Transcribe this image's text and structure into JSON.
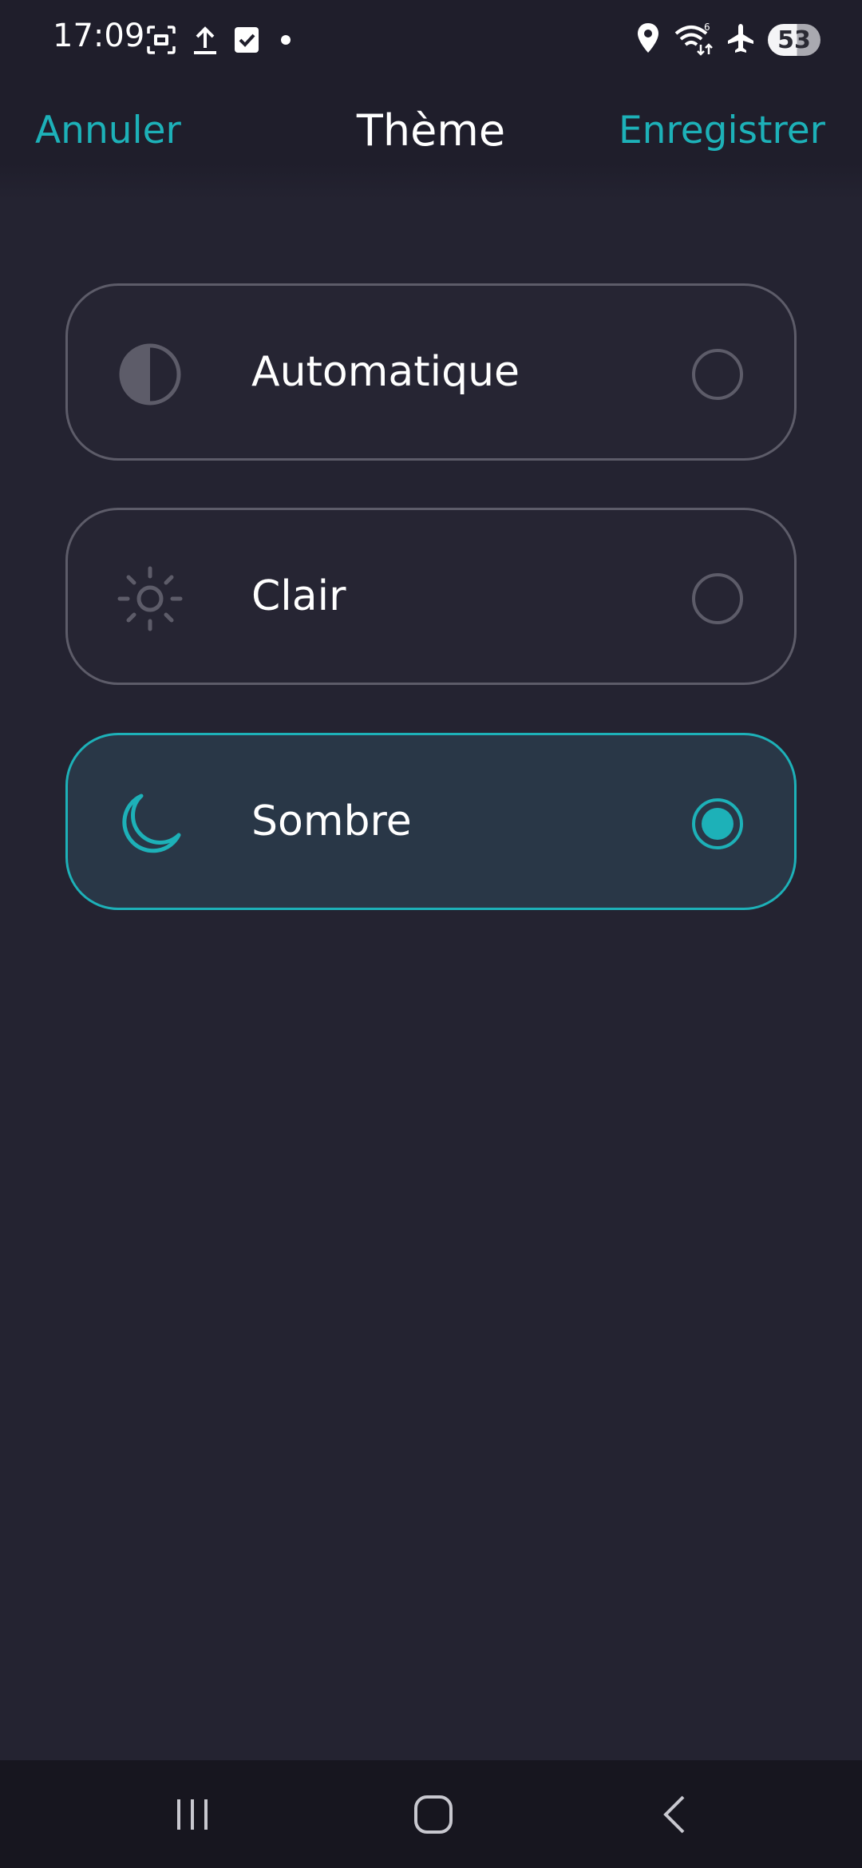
{
  "status_bar": {
    "time": "17:09",
    "left_icons": [
      "screenshot-icon",
      "upload-icon",
      "checkbox-icon",
      "dot-icon"
    ],
    "right_icons": [
      "location-icon",
      "wifi-icon",
      "airplane-icon"
    ],
    "battery": "53"
  },
  "header": {
    "cancel_label": "Annuler",
    "title": "Thème",
    "save_label": "Enregistrer"
  },
  "options": [
    {
      "label": "Automatique",
      "icon": "half-circle-icon",
      "selected": false
    },
    {
      "label": "Clair",
      "icon": "sun-icon",
      "selected": false
    },
    {
      "label": "Sombre",
      "icon": "moon-icon",
      "selected": true
    }
  ],
  "navigation": {
    "buttons": [
      "recent-apps-icon",
      "home-icon",
      "back-icon"
    ]
  },
  "colors": {
    "accent": "#1db1b8",
    "background": "#242331",
    "border": "#5d5c69",
    "selected_background": "#293747"
  }
}
